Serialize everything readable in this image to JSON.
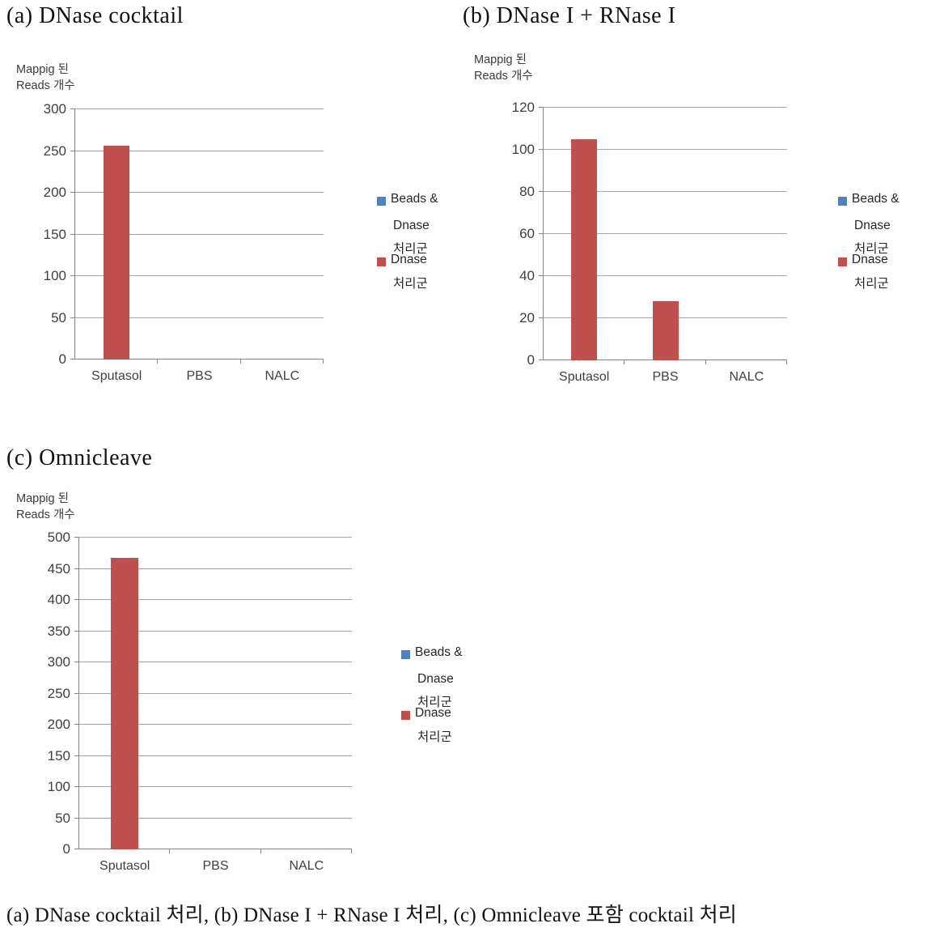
{
  "figure": {
    "caption": "(a) DNase cocktail 처리, (b) DNase I + RNase I 처리, (c) Omnicleave 포함 cocktail 처리"
  },
  "legend": {
    "series1": {
      "color": "#4f81bd",
      "line1": "Beads &",
      "line2": "Dnase",
      "line3": "처리군"
    },
    "series2": {
      "color": "#c0504d",
      "line1": "Dnase",
      "line2": "처리군"
    }
  },
  "panels": [
    {
      "title": "(a)  DNase  cocktail",
      "axis_title_line1": "Mappig 된",
      "axis_title_line2": "Reads 개수",
      "chart_data": {
        "type": "bar",
        "title": "(a) DNase cocktail",
        "xlabel": "",
        "ylabel": "Mappig 된 Reads 개수",
        "categories": [
          "Sputasol",
          "PBS",
          "NALC"
        ],
        "series": [
          {
            "name": "Beads & Dnase 처리군",
            "color": "#4f81bd",
            "values": [
              0,
              0,
              0
            ]
          },
          {
            "name": "Dnase 처리군",
            "color": "#c0504d",
            "values": [
              256,
              0,
              0
            ]
          }
        ],
        "ylim": [
          0,
          300
        ],
        "ytick_step": 50,
        "yticks": [
          0,
          50,
          100,
          150,
          200,
          250,
          300
        ],
        "ytick_labels": [
          "0",
          "50",
          "100",
          "150",
          "200",
          "250",
          "300"
        ],
        "grid": true,
        "legend_position": "right"
      }
    },
    {
      "title": "(b)  DNase I + RNase I",
      "axis_title_line1": "Mappig 된",
      "axis_title_line2": "Reads 개수",
      "chart_data": {
        "type": "bar",
        "title": "(b) DNase I + RNase I",
        "xlabel": "",
        "ylabel": "Mappig 된 Reads 개수",
        "categories": [
          "Sputasol",
          "PBS",
          "NALC"
        ],
        "series": [
          {
            "name": "Beads & Dnase 처리군",
            "color": "#4f81bd",
            "values": [
              0,
              0,
              0
            ]
          },
          {
            "name": "Dnase 처리군",
            "color": "#c0504d",
            "values": [
              105,
              28,
              0
            ]
          }
        ],
        "ylim": [
          0,
          120
        ],
        "ytick_step": 20,
        "yticks": [
          0,
          20,
          40,
          60,
          80,
          100,
          120
        ],
        "ytick_labels": [
          "0",
          "20",
          "40",
          "60",
          "80",
          "100",
          "120"
        ],
        "grid": true,
        "legend_position": "right"
      }
    },
    {
      "title": "(c)  Omnicleave",
      "axis_title_line1": "Mappig 된",
      "axis_title_line2": "Reads 개수",
      "chart_data": {
        "type": "bar",
        "title": "(c) Omnicleave",
        "xlabel": "",
        "ylabel": "Mappig 된 Reads 개수",
        "categories": [
          "Sputasol",
          "PBS",
          "NALC"
        ],
        "series": [
          {
            "name": "Beads & Dnase 처리군",
            "color": "#4f81bd",
            "values": [
              0,
              0,
              0
            ]
          },
          {
            "name": "Dnase 처리군",
            "color": "#c0504d",
            "values": [
              467,
              0,
              0
            ]
          }
        ],
        "ylim": [
          0,
          500
        ],
        "ytick_step": 50,
        "yticks": [
          0,
          50,
          100,
          150,
          200,
          250,
          300,
          350,
          400,
          450,
          500
        ],
        "ytick_labels": [
          "0",
          "50",
          "100",
          "150",
          "200",
          "250",
          "300",
          "350",
          "400",
          "450",
          "500"
        ],
        "grid": true,
        "legend_position": "right"
      }
    }
  ]
}
